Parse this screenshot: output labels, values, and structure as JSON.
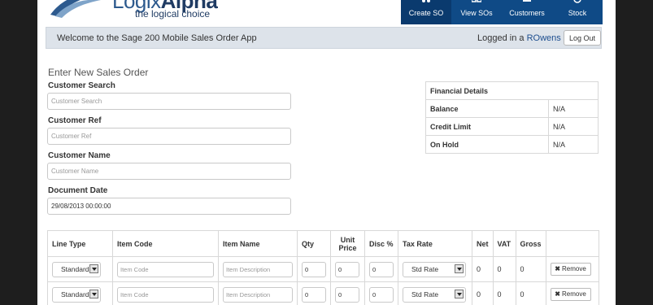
{
  "header": {
    "logo_name_bold": "Alpha",
    "logo_name_light": "Logix",
    "tagline": "the logical choice",
    "nav": [
      {
        "label": "Create SO",
        "icon": "cart-icon",
        "active": true
      },
      {
        "label": "View SOs",
        "icon": "list-icon",
        "active": false
      },
      {
        "label": "Customers",
        "icon": "users-icon",
        "active": false
      },
      {
        "label": "Stock",
        "icon": "box-icon",
        "active": false
      }
    ],
    "accent": "#0f4a86"
  },
  "welcome": {
    "message": "Welcome to the Sage 200 Mobile Sales Order App",
    "logged_prefix": "Logged in a ",
    "user": "ROwens",
    "logout_label": "Log Out"
  },
  "form": {
    "title": "Enter New Sales Order",
    "customer_search": {
      "label": "Customer Search",
      "placeholder": "Customer Search"
    },
    "customer_ref": {
      "label": "Customer Ref",
      "placeholder": "Customer Ref"
    },
    "customer_name": {
      "label": "Customer Name",
      "placeholder": "Customer Name"
    },
    "document_date": {
      "label": "Document Date",
      "value": "29/08/2013 00:00:00"
    }
  },
  "financial": {
    "header": "Financial Details",
    "rows": [
      {
        "label": "Balance",
        "value": "N/A"
      },
      {
        "label": "Credit Limit",
        "value": "N/A"
      },
      {
        "label": "On Hold",
        "value": "N/A"
      }
    ]
  },
  "lines": {
    "headers": {
      "line_type": "Line Type",
      "item_code": "Item Code",
      "item_name": "Item Name",
      "qty": "Qty",
      "unit_price": "Unit Price",
      "disc": "Disc %",
      "tax_rate": "Tax Rate",
      "net": "Net",
      "vat": "VAT",
      "gross": "Gross"
    },
    "rows": [
      {
        "line_type": "Standard",
        "item_code_ph": "Item Code",
        "item_desc_ph": "Item Description",
        "qty": "0",
        "unit_price": "0",
        "disc": "0",
        "tax_rate": "Std Rate",
        "net": "0",
        "vat": "0",
        "gross": "0",
        "remove": "Remove"
      },
      {
        "line_type": "Standard",
        "item_code_ph": "Item Code",
        "item_desc_ph": "Item Description",
        "qty": "0",
        "unit_price": "0",
        "disc": "0",
        "tax_rate": "Std Rate",
        "net": "0",
        "vat": "0",
        "gross": "0",
        "remove": "Remove"
      }
    ]
  }
}
